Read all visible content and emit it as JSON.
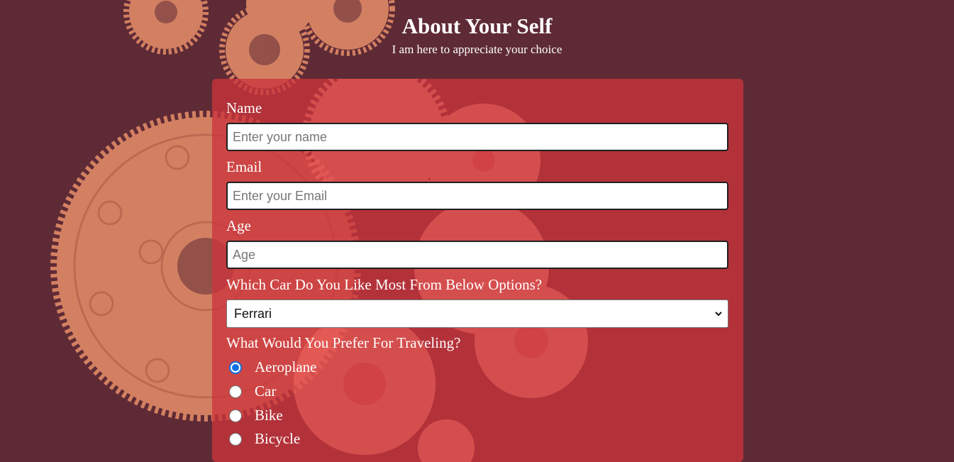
{
  "header": {
    "title": "About Your Self",
    "subtitle": "I am here to appreciate your choice"
  },
  "form": {
    "name": {
      "label": "Name",
      "placeholder": "Enter your name"
    },
    "email": {
      "label": "Email",
      "placeholder": "Enter your Email"
    },
    "age": {
      "label": "Age",
      "placeholder": "Age"
    },
    "car": {
      "label": "Which Car Do You Like Most From Below Options?",
      "selected": "Ferrari"
    },
    "travel": {
      "label": "What Would You Prefer For Traveling?",
      "options": [
        "Aeroplane",
        "Car",
        "Bike",
        "Bicycle"
      ],
      "selected": "Aeroplane"
    }
  },
  "colors": {
    "page_background": "#5e2a35",
    "card": "#cc353c",
    "gear": "#e8906a",
    "radio_accent": "#0f6fe6"
  },
  "icons": {
    "select_arrow": "chevron-down-icon"
  }
}
